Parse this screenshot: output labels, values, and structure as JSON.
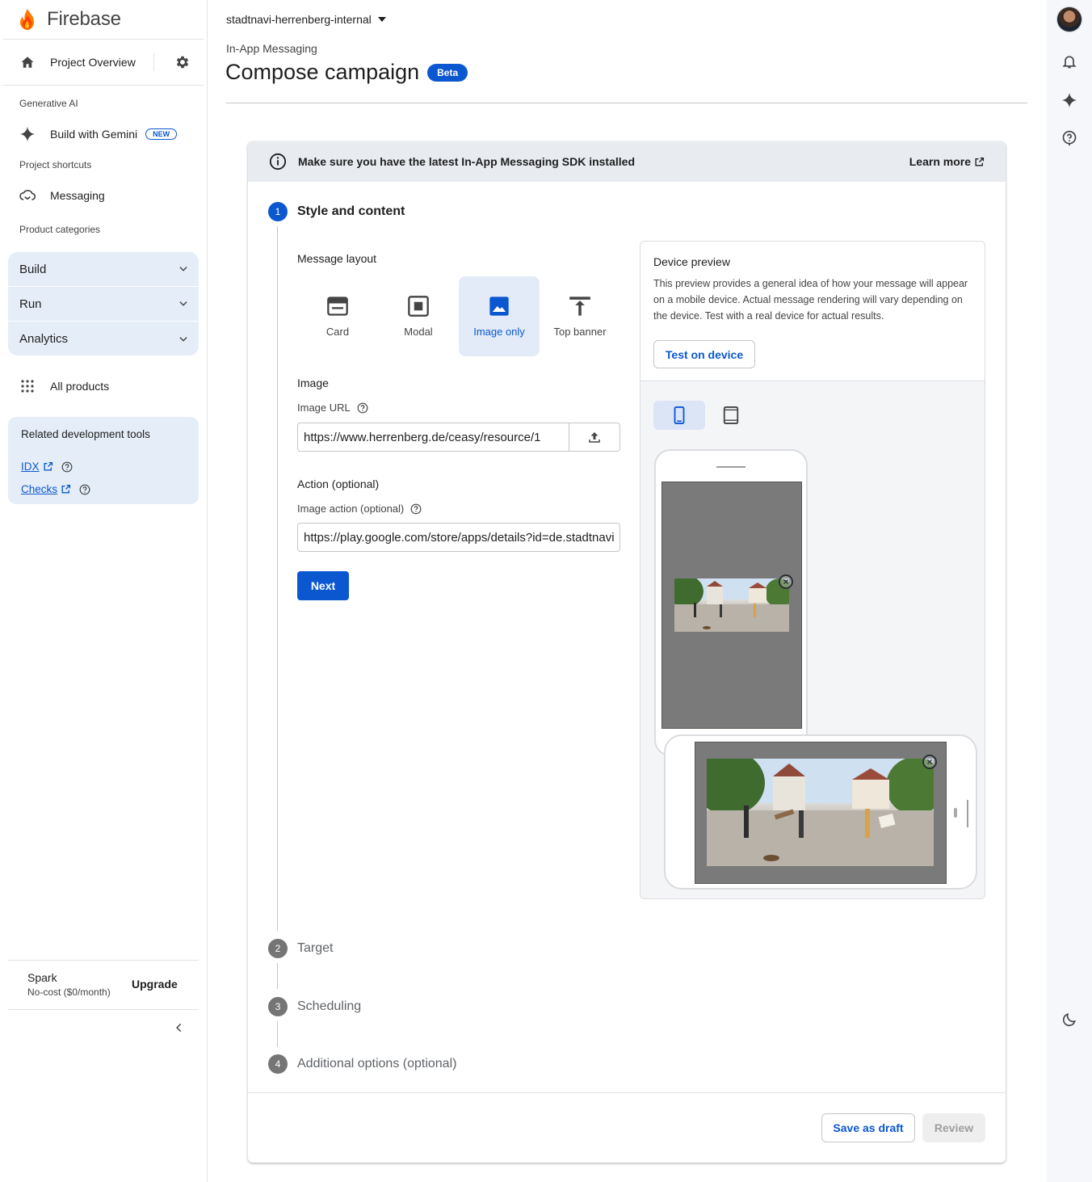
{
  "sidebar": {
    "brand": "Firebase",
    "project_overview": "Project Overview",
    "generative_ai_label": "Generative AI",
    "build_with_gemini": "Build with Gemini",
    "new_badge": "NEW",
    "project_shortcuts_label": "Project shortcuts",
    "messaging": "Messaging",
    "product_categories_label": "Product categories",
    "categories": [
      {
        "label": "Build"
      },
      {
        "label": "Run"
      },
      {
        "label": "Analytics"
      }
    ],
    "all_products": "All products",
    "related_tools": {
      "title": "Related development tools",
      "links": [
        {
          "label": "IDX"
        },
        {
          "label": "Checks"
        }
      ]
    },
    "plan": {
      "name": "Spark",
      "desc": "No-cost ($0/month)",
      "upgrade": "Upgrade"
    }
  },
  "header": {
    "project_name": "stadtnavi-herrenberg-internal",
    "breadcrumb": "In-App Messaging",
    "title": "Compose campaign",
    "badge": "Beta"
  },
  "banner": {
    "text": "Make sure you have the latest In-App Messaging SDK installed",
    "learn_more": "Learn more"
  },
  "steps": [
    {
      "num": "1",
      "title": "Style and content"
    },
    {
      "num": "2",
      "title": "Target"
    },
    {
      "num": "3",
      "title": "Scheduling"
    },
    {
      "num": "4",
      "title": "Additional options (optional)"
    }
  ],
  "form": {
    "message_layout_label": "Message layout",
    "layouts": [
      {
        "label": "Card",
        "icon": "card-icon"
      },
      {
        "label": "Modal",
        "icon": "modal-icon"
      },
      {
        "label": "Image only",
        "icon": "image-icon"
      },
      {
        "label": "Top banner",
        "icon": "top-banner-icon"
      }
    ],
    "selected_layout": "Image only",
    "image_label": "Image",
    "image_url_label": "Image URL",
    "image_url_value": "https://www.herrenberg.de/ceasy/resource/1",
    "action_label": "Action (optional)",
    "image_action_label": "Image action (optional)",
    "image_action_value": "https://play.google.com/store/apps/details?id=de.stadtnavi",
    "next": "Next"
  },
  "preview": {
    "title": "Device preview",
    "description": "This preview provides a general idea of how your message will appear on a mobile device. Actual message rendering will vary depending on the device. Test with a real device for actual results.",
    "test_button": "Test on device",
    "devices": [
      "phone-icon",
      "tablet-icon"
    ],
    "selected_device": "phone-icon"
  },
  "footer": {
    "save_draft": "Save as draft",
    "review": "Review"
  },
  "colors": {
    "accent": "#0b57d0",
    "selected_bg": "#e3ebf9",
    "sidebar_group_bg": "#e5edf8"
  }
}
